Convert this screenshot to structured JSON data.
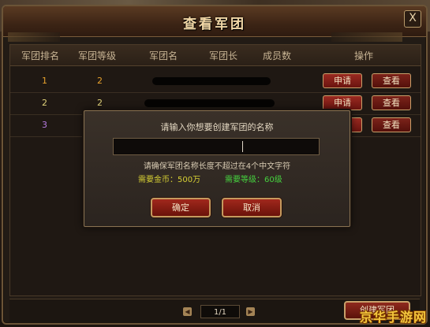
{
  "window": {
    "title": "查看军团",
    "close_label": "X"
  },
  "table": {
    "headers": [
      "军团排名",
      "军团等级",
      "军团名",
      "军团长",
      "成员数",
      "操作"
    ],
    "rows": [
      {
        "rank": "1",
        "level": "2",
        "apply": "申请",
        "view": "查看",
        "rank_color": "#e7a12c"
      },
      {
        "rank": "2",
        "level": "2",
        "apply": "申请",
        "view": "查看",
        "rank_color": "#e0d27a"
      },
      {
        "rank": "3",
        "level": "",
        "apply": "申请",
        "view": "查看",
        "rank_color": "#b57be0"
      }
    ]
  },
  "dialog": {
    "prompt": "请输入你想要创建军团的名称",
    "input_value": "",
    "note": "请确保军团名称长度不超过在4个中文字符",
    "gold_req": "需要金币：500万",
    "level_req": "需要等级：60级",
    "confirm_label": "确定",
    "cancel_label": "取消"
  },
  "footer": {
    "page": "1/1",
    "prev_icon": "arrow-left-icon",
    "next_icon": "arrow-right-icon",
    "create_label": "创建军团"
  },
  "watermark": {
    "text": "京华手游网"
  },
  "colors": {
    "accent_red": "#8f2a1e",
    "gold_text": "#d6cf34",
    "green_text": "#46d23f",
    "border_gold": "#c8a06a"
  }
}
